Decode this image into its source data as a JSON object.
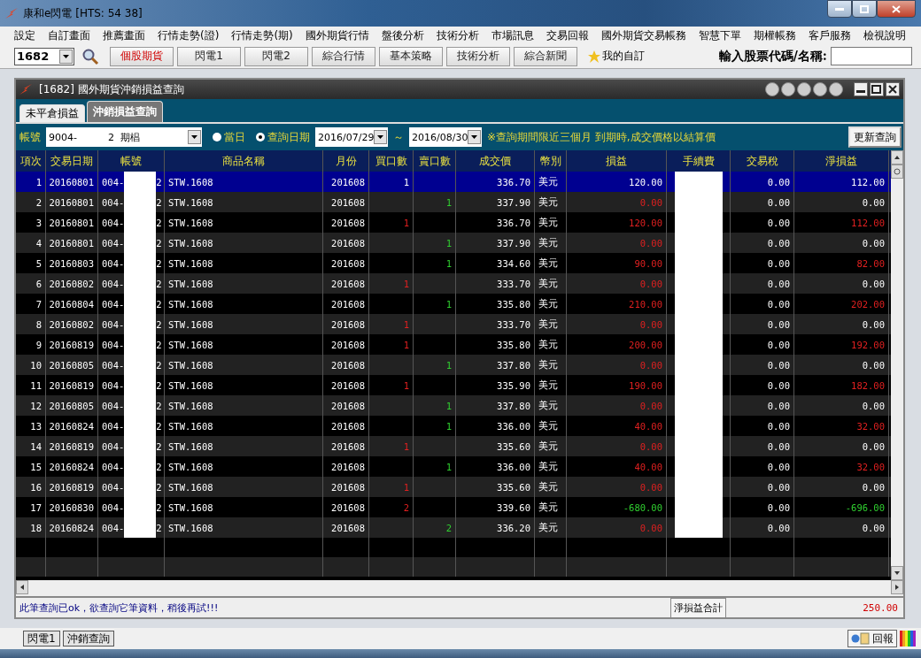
{
  "window": {
    "title": "康和e閃電  [HTS: 54 38]"
  },
  "menu": [
    "設定",
    "自訂畫面",
    "推薦畫面",
    "行情走勢(證)",
    "行情走勢(期)",
    "國外期貨行情",
    "盤後分析",
    "技術分析",
    "市場訊息",
    "交易回報",
    "國外期貨交易帳務",
    "智慧下單",
    "期權帳務",
    "客戶服務",
    "檢視說明"
  ],
  "toolbar": {
    "code": "1682",
    "buttons": [
      {
        "label": "個股期貨",
        "selected": true
      },
      {
        "label": "閃電1",
        "selected": false
      },
      {
        "label": "閃電2",
        "selected": false
      },
      {
        "label": "綜合行情",
        "selected": false
      },
      {
        "label": "基本策略",
        "selected": false
      },
      {
        "label": "技術分析",
        "selected": false
      },
      {
        "label": "綜合新聞",
        "selected": false
      }
    ],
    "favorites": "我的自訂",
    "search_label": "輸入股票代碼/名稱:"
  },
  "panel": {
    "title": "[1682] 國外期貨沖銷損益查詢",
    "tabs": [
      {
        "label": "未平倉損益",
        "selected": false
      },
      {
        "label": "沖銷損益查詢",
        "selected": true
      }
    ],
    "filter": {
      "account_label": "帳號",
      "account": "9004-          2  期椙",
      "radios": [
        {
          "label": "當日",
          "selected": false
        },
        {
          "label": "查詢日期",
          "selected": true
        }
      ],
      "date_from": "2016/07/29",
      "tilde": "～",
      "date_to": "2016/08/30",
      "note": "※查詢期間限近三個月 到期時,成交價格以結算價",
      "refresh": "更新查詢"
    },
    "table": {
      "columns": [
        "項次",
        "交易日期",
        "帳號",
        "商品名稱",
        "月份",
        "買口數",
        "賣口數",
        "成交價",
        "幣別",
        "損益",
        "手續費",
        "交易稅",
        "淨損益"
      ],
      "rows": [
        {
          "no": "1",
          "date": "20160801",
          "account_head": "004-",
          "account_tail": "2",
          "product": "STW.1608",
          "month": "201608",
          "buy": "1",
          "sell": "",
          "price": "336.70",
          "currency": "美元",
          "pl": "120.00",
          "pl_marked": false,
          "pl_negative": false,
          "tax": "0.00",
          "net": "112.00",
          "net_marked": false,
          "net_negative": false,
          "selected": true
        },
        {
          "no": "2",
          "date": "20160801",
          "account_head": "004-",
          "account_tail": "2",
          "product": "STW.1608",
          "month": "201608",
          "buy": "",
          "sell": "1",
          "price": "337.90",
          "currency": "美元",
          "pl": "0.00",
          "pl_marked": true,
          "pl_negative": false,
          "tax": "0.00",
          "net": "0.00",
          "net_marked": false,
          "net_negative": false,
          "selected": false
        },
        {
          "no": "3",
          "date": "20160801",
          "account_head": "004-",
          "account_tail": "2",
          "product": "STW.1608",
          "month": "201608",
          "buy": "1",
          "sell": "",
          "price": "336.70",
          "currency": "美元",
          "pl": "120.00",
          "pl_marked": true,
          "pl_negative": false,
          "tax": "0.00",
          "net": "112.00",
          "net_marked": true,
          "net_negative": false,
          "selected": false
        },
        {
          "no": "4",
          "date": "20160801",
          "account_head": "004-",
          "account_tail": "2",
          "product": "STW.1608",
          "month": "201608",
          "buy": "",
          "sell": "1",
          "price": "337.90",
          "currency": "美元",
          "pl": "0.00",
          "pl_marked": true,
          "pl_negative": false,
          "tax": "0.00",
          "net": "0.00",
          "net_marked": false,
          "net_negative": false,
          "selected": false
        },
        {
          "no": "5",
          "date": "20160803",
          "account_head": "004-",
          "account_tail": "2",
          "product": "STW.1608",
          "month": "201608",
          "buy": "",
          "sell": "1",
          "price": "334.60",
          "currency": "美元",
          "pl": "90.00",
          "pl_marked": true,
          "pl_negative": false,
          "tax": "0.00",
          "net": "82.00",
          "net_marked": true,
          "net_negative": false,
          "selected": false
        },
        {
          "no": "6",
          "date": "20160802",
          "account_head": "004-",
          "account_tail": "2",
          "product": "STW.1608",
          "month": "201608",
          "buy": "1",
          "sell": "",
          "price": "333.70",
          "currency": "美元",
          "pl": "0.00",
          "pl_marked": true,
          "pl_negative": false,
          "tax": "0.00",
          "net": "0.00",
          "net_marked": false,
          "net_negative": false,
          "selected": false
        },
        {
          "no": "7",
          "date": "20160804",
          "account_head": "004-",
          "account_tail": "2",
          "product": "STW.1608",
          "month": "201608",
          "buy": "",
          "sell": "1",
          "price": "335.80",
          "currency": "美元",
          "pl": "210.00",
          "pl_marked": true,
          "pl_negative": false,
          "tax": "0.00",
          "net": "202.00",
          "net_marked": true,
          "net_negative": false,
          "selected": false
        },
        {
          "no": "8",
          "date": "20160802",
          "account_head": "004-",
          "account_tail": "2",
          "product": "STW.1608",
          "month": "201608",
          "buy": "1",
          "sell": "",
          "price": "333.70",
          "currency": "美元",
          "pl": "0.00",
          "pl_marked": true,
          "pl_negative": false,
          "tax": "0.00",
          "net": "0.00",
          "net_marked": false,
          "net_negative": false,
          "selected": false
        },
        {
          "no": "9",
          "date": "20160819",
          "account_head": "004-",
          "account_tail": "2",
          "product": "STW.1608",
          "month": "201608",
          "buy": "1",
          "sell": "",
          "price": "335.80",
          "currency": "美元",
          "pl": "200.00",
          "pl_marked": true,
          "pl_negative": false,
          "tax": "0.00",
          "net": "192.00",
          "net_marked": true,
          "net_negative": false,
          "selected": false
        },
        {
          "no": "10",
          "date": "20160805",
          "account_head": "004-",
          "account_tail": "2",
          "product": "STW.1608",
          "month": "201608",
          "buy": "",
          "sell": "1",
          "price": "337.80",
          "currency": "美元",
          "pl": "0.00",
          "pl_marked": true,
          "pl_negative": false,
          "tax": "0.00",
          "net": "0.00",
          "net_marked": false,
          "net_negative": false,
          "selected": false
        },
        {
          "no": "11",
          "date": "20160819",
          "account_head": "004-",
          "account_tail": "2",
          "product": "STW.1608",
          "month": "201608",
          "buy": "1",
          "sell": "",
          "price": "335.90",
          "currency": "美元",
          "pl": "190.00",
          "pl_marked": true,
          "pl_negative": false,
          "tax": "0.00",
          "net": "182.00",
          "net_marked": true,
          "net_negative": false,
          "selected": false
        },
        {
          "no": "12",
          "date": "20160805",
          "account_head": "004-",
          "account_tail": "2",
          "product": "STW.1608",
          "month": "201608",
          "buy": "",
          "sell": "1",
          "price": "337.80",
          "currency": "美元",
          "pl": "0.00",
          "pl_marked": true,
          "pl_negative": false,
          "tax": "0.00",
          "net": "0.00",
          "net_marked": false,
          "net_negative": false,
          "selected": false
        },
        {
          "no": "13",
          "date": "20160824",
          "account_head": "004-",
          "account_tail": "2",
          "product": "STW.1608",
          "month": "201608",
          "buy": "",
          "sell": "1",
          "price": "336.00",
          "currency": "美元",
          "pl": "40.00",
          "pl_marked": true,
          "pl_negative": false,
          "tax": "0.00",
          "net": "32.00",
          "net_marked": true,
          "net_negative": false,
          "selected": false
        },
        {
          "no": "14",
          "date": "20160819",
          "account_head": "004-",
          "account_tail": "2",
          "product": "STW.1608",
          "month": "201608",
          "buy": "1",
          "sell": "",
          "price": "335.60",
          "currency": "美元",
          "pl": "0.00",
          "pl_marked": true,
          "pl_negative": false,
          "tax": "0.00",
          "net": "0.00",
          "net_marked": false,
          "net_negative": false,
          "selected": false
        },
        {
          "no": "15",
          "date": "20160824",
          "account_head": "004-",
          "account_tail": "2",
          "product": "STW.1608",
          "month": "201608",
          "buy": "",
          "sell": "1",
          "price": "336.00",
          "currency": "美元",
          "pl": "40.00",
          "pl_marked": true,
          "pl_negative": false,
          "tax": "0.00",
          "net": "32.00",
          "net_marked": true,
          "net_negative": false,
          "selected": false
        },
        {
          "no": "16",
          "date": "20160819",
          "account_head": "004-",
          "account_tail": "2",
          "product": "STW.1608",
          "month": "201608",
          "buy": "1",
          "sell": "",
          "price": "335.60",
          "currency": "美元",
          "pl": "0.00",
          "pl_marked": true,
          "pl_negative": false,
          "tax": "0.00",
          "net": "0.00",
          "net_marked": false,
          "net_negative": false,
          "selected": false
        },
        {
          "no": "17",
          "date": "20160830",
          "account_head": "004-",
          "account_tail": "2",
          "product": "STW.1608",
          "month": "201608",
          "buy": "2",
          "sell": "",
          "price": "339.60",
          "currency": "美元",
          "pl": "-680.00",
          "pl_marked": false,
          "pl_negative": true,
          "tax": "0.00",
          "net": "-696.00",
          "net_marked": false,
          "net_negative": true,
          "selected": false
        },
        {
          "no": "18",
          "date": "20160824",
          "account_head": "004-",
          "account_tail": "2",
          "product": "STW.1608",
          "month": "201608",
          "buy": "",
          "sell": "2",
          "price": "336.20",
          "currency": "美元",
          "pl": "0.00",
          "pl_marked": true,
          "pl_negative": false,
          "tax": "0.00",
          "net": "0.00",
          "net_marked": false,
          "net_negative": false,
          "selected": false
        }
      ]
    },
    "status": {
      "message": "此筆查詢已ok，欲查詢它筆資料，稍後再試!!!",
      "total_label": "淨損益合計",
      "total": "250.00"
    }
  },
  "taskbar": {
    "tabs": [
      "閃電1",
      "沖銷查詢"
    ],
    "report": "回報"
  }
}
